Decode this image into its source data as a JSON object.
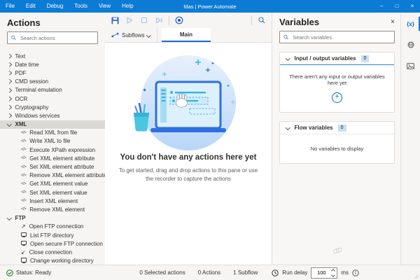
{
  "titlebar": {
    "menus": [
      "File",
      "Edit",
      "Debug",
      "Tools",
      "View",
      "Help"
    ],
    "title": "fdas | Power Automate",
    "window": {
      "minimize": "–",
      "maximize": "□",
      "close": "×"
    }
  },
  "actions": {
    "title": "Actions",
    "search_placeholder": "Search actions",
    "collapsed": [
      "Text",
      "Date time",
      "PDF",
      "CMD session",
      "Terminal emulation",
      "OCR",
      "Cryptography",
      "Windows services"
    ],
    "xml_group": {
      "label": "XML",
      "items": [
        "Read XML from file",
        "Write XML to file",
        "Execute XPath expression",
        "Get XML element attribute",
        "Set XML element attribute",
        "Remove XML element attribute",
        "Get XML element value",
        "Set XML element value",
        "Insert XML element",
        "Remove XML element"
      ]
    },
    "ftp_group": {
      "label": "FTP",
      "items": [
        "Open FTP connection",
        "List FTP directory",
        "Open secure FTP connection",
        "Close connection",
        "Change working directory"
      ]
    }
  },
  "workspace": {
    "tabs": {
      "subflows_label": "Subflows",
      "main_tab": "Main"
    },
    "empty_state": {
      "heading": "You don't have any actions here yet",
      "subtext": "To get started, drag and drop actions to this pane or use the recorder to capture the actions"
    }
  },
  "variables": {
    "title": "Variables",
    "search_placeholder": "Search variables",
    "sections": [
      {
        "label": "Input / output variables",
        "count": "0",
        "empty_text": "There aren't any input or output variables here yet"
      },
      {
        "label": "Flow variables",
        "count": "0",
        "empty_text": "No variables to display"
      }
    ]
  },
  "statusbar": {
    "status": "Status: Ready",
    "selected_actions": "0 Selected actions",
    "actions_count": "0 Actions",
    "subflow_count": "1 Subflow",
    "run_delay_label": "Run delay",
    "run_delay_value": "100",
    "run_delay_unit": "ms"
  },
  "icons": {
    "xml_item": "</>",
    "open_connection": "↗",
    "close_connection": "↙",
    "variables_pane": "{x}",
    "add": "+"
  },
  "colors": {
    "accent": "#0c7bd6",
    "tab_underline": "#1a6fc4",
    "status_ok": "#107c10",
    "badge_bg": "#c7e0f4"
  }
}
